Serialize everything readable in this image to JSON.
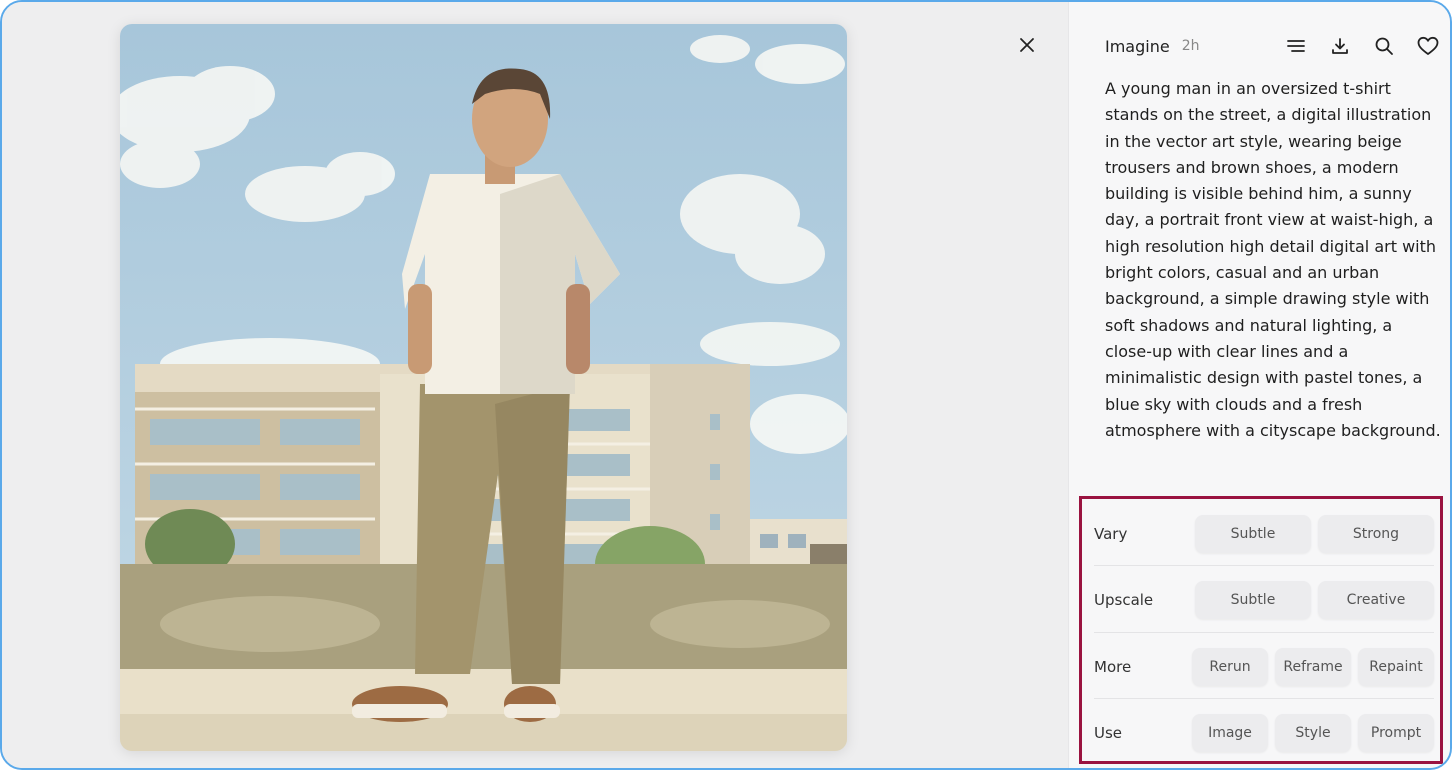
{
  "panel": {
    "title": "Imagine",
    "time": "2h",
    "prompt": "A young man in an oversized t-shirt stands on the street, a digital illustration in the vector art style, wearing beige trousers and brown shoes, a modern building is visible behind him, a sunny day, a portrait front view at waist-high, a high resolution high detail digital art with bright colors, casual and an urban background, a simple drawing style with soft shadows and natural lighting, a close-up with clear lines and a minimalistic design with pastel tones, a blue sky with clouds and a fresh atmosphere with a cityscape background.",
    "icons": [
      "menu-icon",
      "download-icon",
      "search-icon",
      "heart-icon"
    ]
  },
  "actions": {
    "vary": {
      "label": "Vary",
      "buttons": [
        "Subtle",
        "Strong"
      ]
    },
    "upscale": {
      "label": "Upscale",
      "buttons": [
        "Subtle",
        "Creative"
      ]
    },
    "more": {
      "label": "More",
      "buttons": [
        "Rerun",
        "Reframe",
        "Repaint"
      ]
    },
    "use": {
      "label": "Use",
      "buttons": [
        "Image",
        "Style",
        "Prompt"
      ]
    }
  },
  "colors": {
    "highlight_border": "#9a1340",
    "frame_border": "#5aa9ea",
    "sky": "#a9c9dd"
  }
}
